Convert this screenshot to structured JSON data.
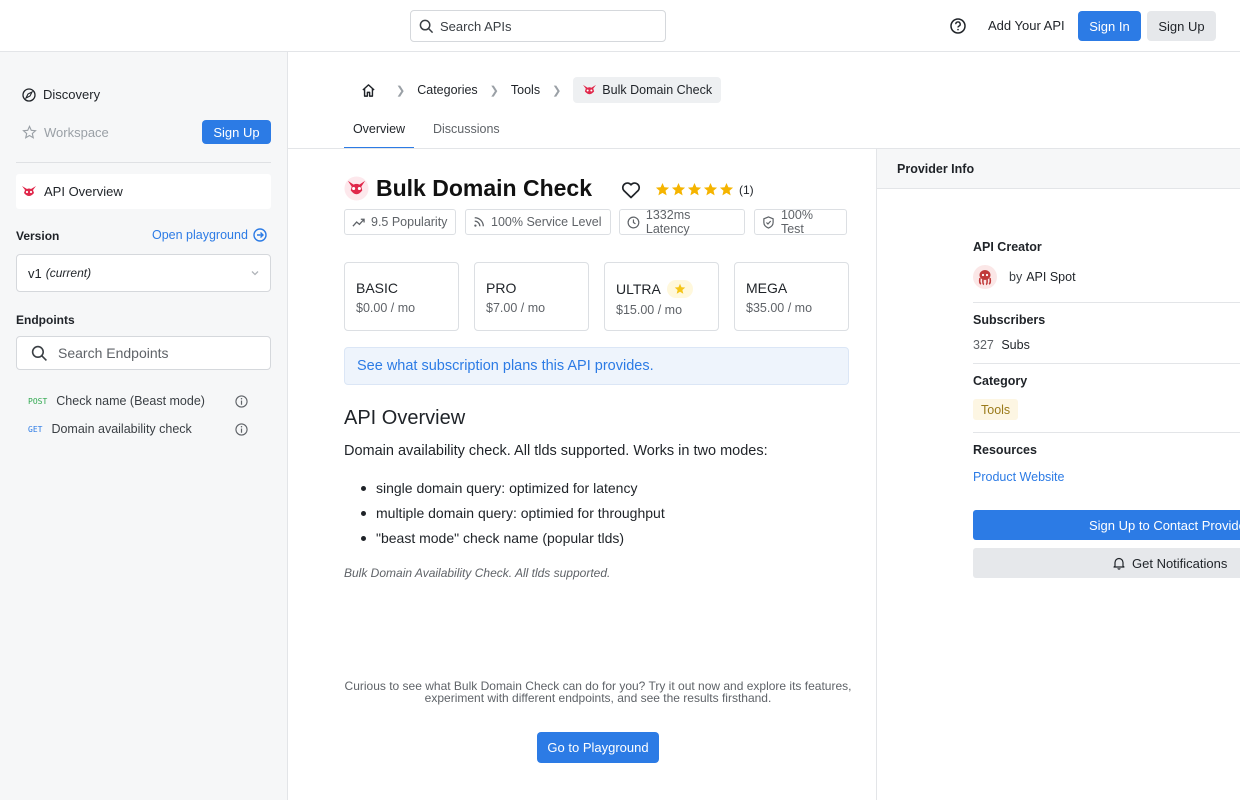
{
  "topbar": {
    "search_placeholder": "Search APIs",
    "add_api": "Add Your API",
    "sign_in": "Sign In",
    "sign_up": "Sign Up"
  },
  "sidebar": {
    "discovery": "Discovery",
    "workspace": "Workspace",
    "sign_up": "Sign Up",
    "api_overview": "API Overview",
    "version_label": "Version",
    "open_playground": "Open playground",
    "version_value": "v1",
    "version_note": "(current)",
    "endpoints_label": "Endpoints",
    "search_endpoints_placeholder": "Search Endpoints",
    "endpoints": [
      {
        "method": "POST",
        "name": "Check name (Beast mode)"
      },
      {
        "method": "GET",
        "name": "Domain availability check"
      }
    ]
  },
  "breadcrumb": {
    "items": [
      "Categories",
      "Tools"
    ],
    "current": "Bulk Domain Check"
  },
  "tabs": [
    {
      "label": "Overview",
      "active": true
    },
    {
      "label": "Discussions",
      "active": false
    }
  ],
  "api": {
    "title": "Bulk Domain Check",
    "rating_count": "(1)",
    "rating": 5,
    "stats": {
      "popularity": "9.5 Popularity",
      "service_level": "100% Service Level",
      "latency": "1332ms Latency",
      "test": "100% Test"
    },
    "plans": [
      {
        "name": "BASIC",
        "price": "$0.00 / mo"
      },
      {
        "name": "PRO",
        "price": "$7.00 / mo"
      },
      {
        "name": "ULTRA",
        "price": "$15.00 / mo",
        "recommended": true
      },
      {
        "name": "MEGA",
        "price": "$35.00 / mo"
      }
    ],
    "plans_info": "See what subscription plans this API provides.",
    "overview_title": "API Overview",
    "overview_desc": "Domain availability check. All tlds supported. Works in two modes:",
    "features": [
      "single domain query: optimized for latency",
      "multiple domain query: optimied for throughput",
      "\"beast mode\" check name (popular tlds)"
    ],
    "note": "Bulk Domain Availability Check. All tlds supported.",
    "cta_text": "Curious to see what Bulk Domain Check can do for you? Try it out now and explore its features, experiment with different endpoints, and see the results firsthand.",
    "cta_button": "Go to Playground"
  },
  "provider": {
    "header": "Provider Info",
    "creator_label": "API Creator",
    "by": "by",
    "creator_name": "API Spot",
    "subscribers_label": "Subscribers",
    "subscribers_count": "327",
    "subscribers_unit": "Subs",
    "category_label": "Category",
    "category": "Tools",
    "resources_label": "Resources",
    "resource_link": "Product Website",
    "contact_button": "Sign Up to Contact Provider",
    "notify_button": "Get Notifications"
  },
  "colors": {
    "accent": "#2c7be5",
    "star": "#f5b400",
    "post": "#2fa84f",
    "get": "#2c7be5"
  }
}
